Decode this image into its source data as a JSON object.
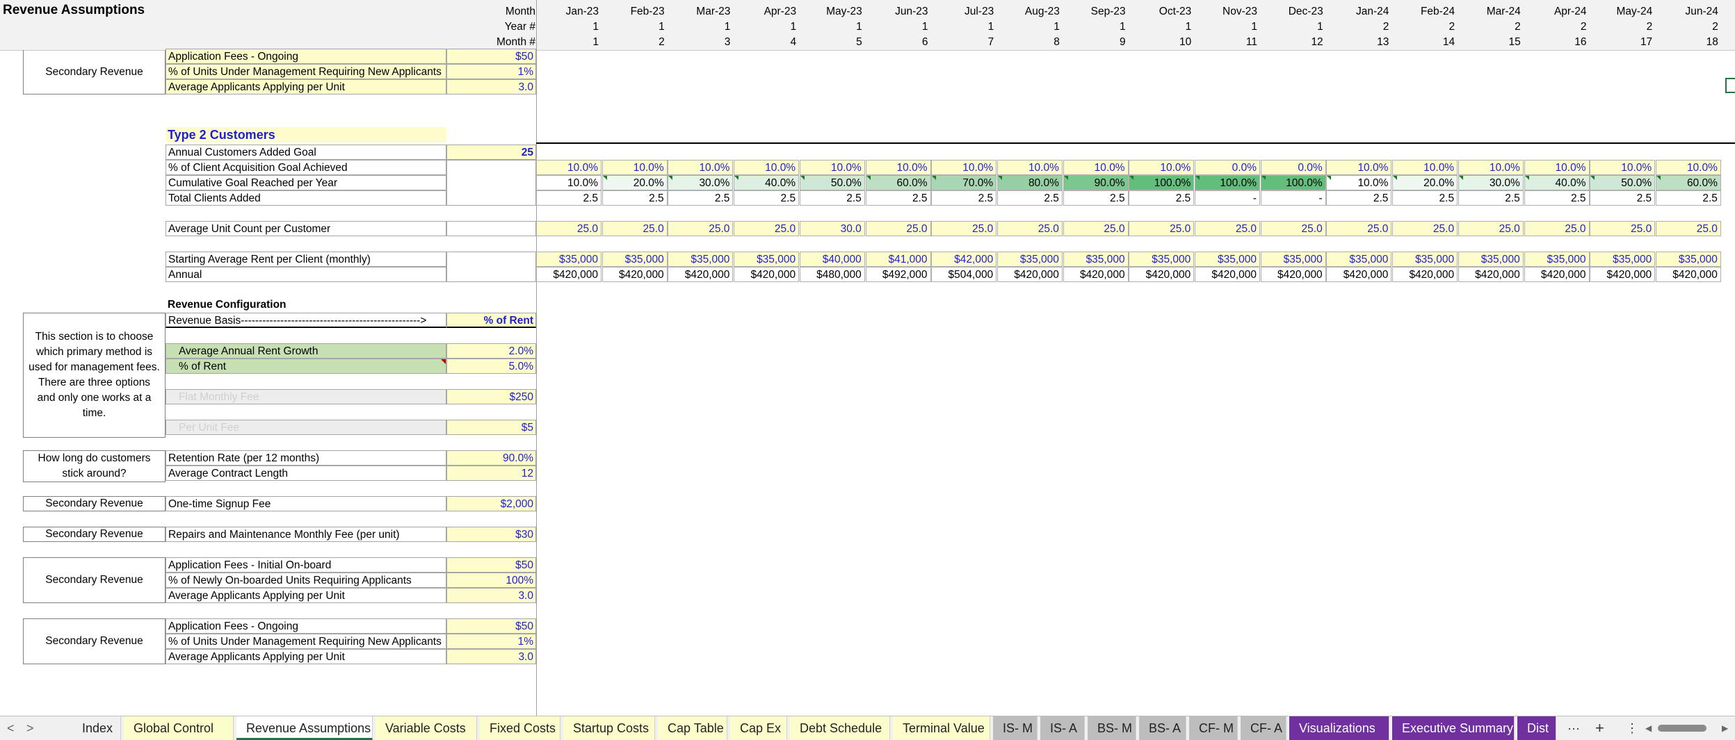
{
  "sheet_title": "Revenue Assumptions",
  "header_labels": {
    "month": "Month",
    "year": "Year #",
    "month_num": "Month #"
  },
  "months": [
    "Jan-23",
    "Feb-23",
    "Mar-23",
    "Apr-23",
    "May-23",
    "Jun-23",
    "Jul-23",
    "Aug-23",
    "Sep-23",
    "Oct-23",
    "Nov-23",
    "Dec-23",
    "Jan-24",
    "Feb-24",
    "Mar-24",
    "Apr-24",
    "May-24",
    "Jun-24"
  ],
  "years": [
    "1",
    "1",
    "1",
    "1",
    "1",
    "1",
    "1",
    "1",
    "1",
    "1",
    "1",
    "1",
    "2",
    "2",
    "2",
    "2",
    "2",
    "2"
  ],
  "month_nums": [
    "1",
    "2",
    "3",
    "4",
    "5",
    "6",
    "7",
    "8",
    "9",
    "10",
    "11",
    "12",
    "13",
    "14",
    "15",
    "16",
    "17",
    "18"
  ],
  "top_block": {
    "box_label": "Secondary Revenue",
    "rows": [
      {
        "label": "Application Fees - Ongoing",
        "value": "$50"
      },
      {
        "label": "% of Units Under Management Requiring New Applicants",
        "value": "1%"
      },
      {
        "label": "Average Applicants Applying per Unit",
        "value": "3.0"
      }
    ]
  },
  "type2": {
    "heading": "Type 2 Customers",
    "goal_label": "Annual Customers Added Goal",
    "goal_value": "25",
    "acq_label": "% of Client Acquisition Goal Achieved",
    "acq_values": [
      "10.0%",
      "10.0%",
      "10.0%",
      "10.0%",
      "10.0%",
      "10.0%",
      "10.0%",
      "10.0%",
      "10.0%",
      "10.0%",
      "0.0%",
      "0.0%",
      "10.0%",
      "10.0%",
      "10.0%",
      "10.0%",
      "10.0%",
      "10.0%"
    ],
    "cum_label": "Cumulative Goal Reached per Year",
    "cum_values": [
      "10.0%",
      "20.0%",
      "30.0%",
      "40.0%",
      "50.0%",
      "60.0%",
      "70.0%",
      "80.0%",
      "90.0%",
      "100.0%",
      "100.0%",
      "100.0%",
      "10.0%",
      "20.0%",
      "30.0%",
      "40.0%",
      "50.0%",
      "60.0%"
    ],
    "cum_levels": [
      0.1,
      0.2,
      0.3,
      0.4,
      0.5,
      0.6,
      0.7,
      0.8,
      0.9,
      1.0,
      1.0,
      1.0,
      0.1,
      0.2,
      0.3,
      0.4,
      0.5,
      0.6
    ],
    "clients_label": "Total Clients Added",
    "clients_values": [
      "2.5",
      "2.5",
      "2.5",
      "2.5",
      "2.5",
      "2.5",
      "2.5",
      "2.5",
      "2.5",
      "2.5",
      "-",
      "-",
      "2.5",
      "2.5",
      "2.5",
      "2.5",
      "2.5",
      "2.5"
    ],
    "unit_label": "Average Unit Count per Customer",
    "unit_values": [
      "25.0",
      "25.0",
      "25.0",
      "25.0",
      "30.0",
      "25.0",
      "25.0",
      "25.0",
      "25.0",
      "25.0",
      "25.0",
      "25.0",
      "25.0",
      "25.0",
      "25.0",
      "25.0",
      "25.0",
      "25.0"
    ],
    "rent_label": "Starting Average Rent per Client (monthly)",
    "rent_values": [
      "$35,000",
      "$35,000",
      "$35,000",
      "$35,000",
      "$40,000",
      "$41,000",
      "$42,000",
      "$35,000",
      "$35,000",
      "$35,000",
      "$35,000",
      "$35,000",
      "$35,000",
      "$35,000",
      "$35,000",
      "$35,000",
      "$35,000",
      "$35,000"
    ],
    "annual_label": "Annual",
    "annual_values": [
      "$420,000",
      "$420,000",
      "$420,000",
      "$420,000",
      "$480,000",
      "$492,000",
      "$504,000",
      "$420,000",
      "$420,000",
      "$420,000",
      "$420,000",
      "$420,000",
      "$420,000",
      "$420,000",
      "$420,000",
      "$420,000",
      "$420,000",
      "$420,000"
    ]
  },
  "revenue_config": {
    "heading": "Revenue Configuration",
    "basis_label": "Revenue Basis-------------------------------------------------->",
    "basis_value": "% of Rent",
    "box_text": "This section is to choose which primary method is used for management fees. There are three options and only one works at a time.",
    "growth_label": "Average Annual Rent Growth",
    "growth_value": "2.0%",
    "pct_label": "% of Rent",
    "pct_value": "5.0%",
    "flat_label": "Flat Monthly Fee",
    "flat_value": "$250",
    "perunit_label": "Per Unit Fee",
    "perunit_value": "$5"
  },
  "retention": {
    "box_text": "How long do customers stick around?",
    "rate_label": "Retention Rate (per 12 months)",
    "rate_value": "90.0%",
    "length_label": "Average Contract Length",
    "length_value": "12"
  },
  "signup": {
    "box_text": "Secondary Revenue",
    "label": "One-time Signup Fee",
    "value": "$2,000"
  },
  "repairs": {
    "box_text": "Secondary Revenue",
    "label": "Repairs and Maintenance Monthly Fee (per unit)",
    "value": "$30"
  },
  "initial_apps": {
    "box_text": "Secondary Revenue",
    "rows": [
      {
        "label": "Application Fees - Initial On-board",
        "value": "$50"
      },
      {
        "label": "% of Newly On-boarded Units Requiring Applicants",
        "value": "100%"
      },
      {
        "label": "Average Applicants Applying per Unit",
        "value": "3.0"
      }
    ]
  },
  "ongoing_apps": {
    "box_text": "Secondary Revenue",
    "rows": [
      {
        "label": "Application Fees - Ongoing",
        "value": "$50"
      },
      {
        "label": "% of Units Under Management Requiring New Applicants",
        "value": "1%"
      },
      {
        "label": "Average Applicants Applying per Unit",
        "value": "3.0"
      }
    ]
  },
  "tabs": [
    {
      "label": "Index",
      "style": "plain"
    },
    {
      "label": "Global Control",
      "style": "yellowtab"
    },
    {
      "label": "Revenue Assumptions",
      "style": "active"
    },
    {
      "label": "Variable Costs",
      "style": "yellowtab"
    },
    {
      "label": "Fixed Costs",
      "style": "yellowtab"
    },
    {
      "label": "Startup Costs",
      "style": "yellowtab"
    },
    {
      "label": "Cap Table",
      "style": "yellowtab"
    },
    {
      "label": "Cap Ex",
      "style": "yellowtab"
    },
    {
      "label": "Debt Schedule",
      "style": "yellowtab"
    },
    {
      "label": "Terminal Value",
      "style": "yellowtab"
    },
    {
      "label": "IS- M",
      "style": "gray"
    },
    {
      "label": "IS- A",
      "style": "gray"
    },
    {
      "label": "BS- M",
      "style": "gray"
    },
    {
      "label": "BS- A",
      "style": "gray"
    },
    {
      "label": "CF- M",
      "style": "gray"
    },
    {
      "label": "CF- A",
      "style": "gray"
    },
    {
      "label": "Visualizations",
      "style": "purple"
    },
    {
      "label": "Executive Summary",
      "style": "purple"
    },
    {
      "label": "Dist",
      "style": "purple"
    }
  ],
  "tab_controls": {
    "prev": "<",
    "next": ">",
    "more": "···",
    "add": "+",
    "options": "⋮",
    "scroll_left": "◀",
    "scroll_right": "▶"
  },
  "colors": {
    "input_yellow": "#fdfdcc",
    "input_blue": "#1f1fd0",
    "type2_heading": "#1f1fd0",
    "tab_purple": "#7030a0",
    "tab_active_underline": "#217346"
  }
}
